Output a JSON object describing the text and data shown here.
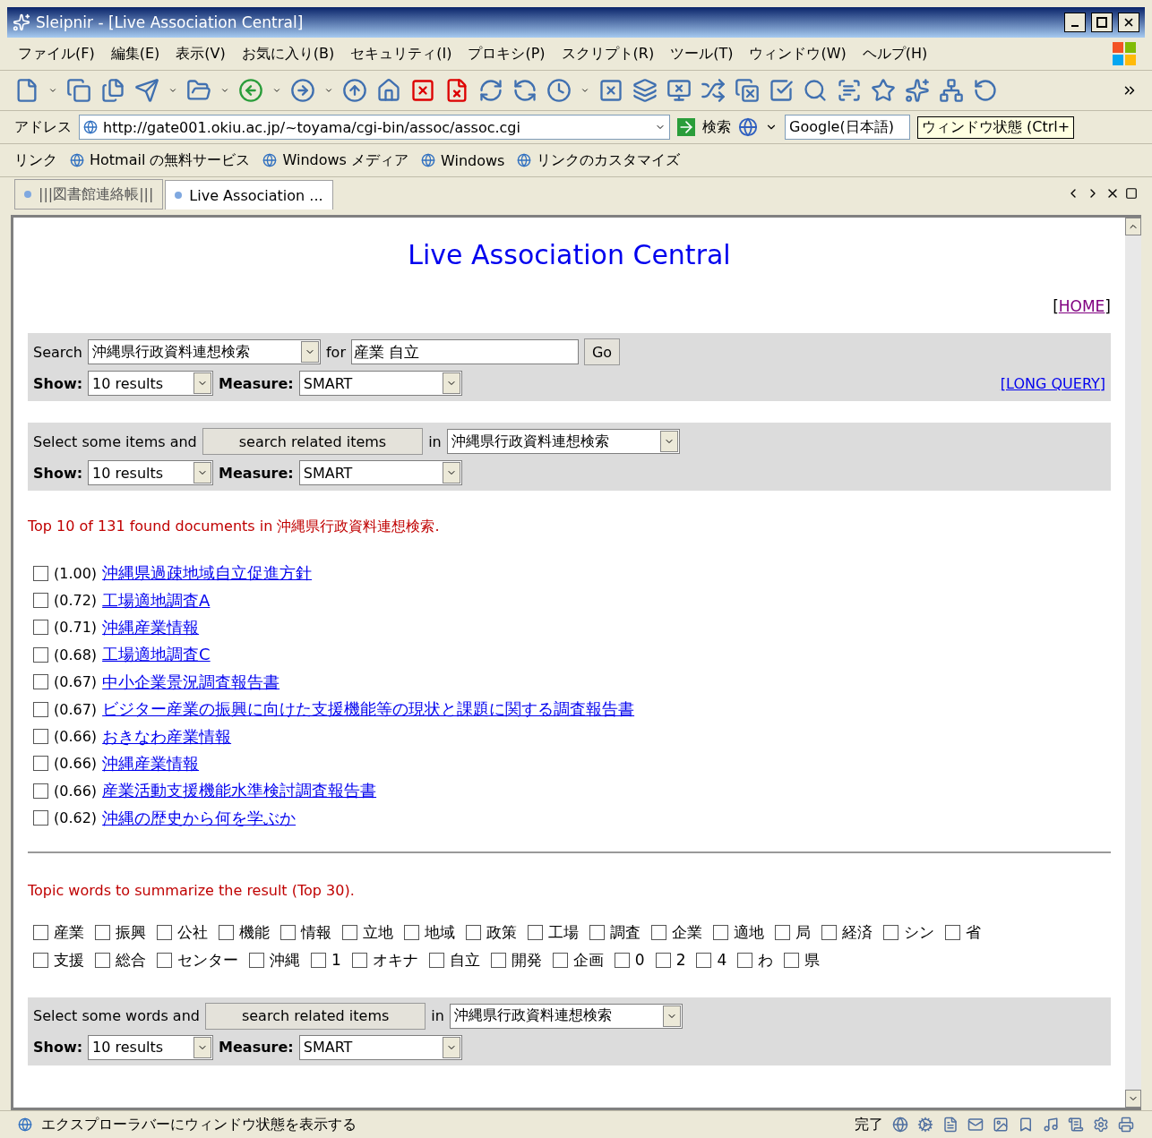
{
  "window": {
    "title": "Sleipnir - [Live Association Central]"
  },
  "menu": [
    "ファイル(F)",
    "編集(E)",
    "表示(V)",
    "お気に入り(B)",
    "セキュリティ(I)",
    "プロキシ(P)",
    "スクリプト(R)",
    "ツール(T)",
    "ウィンドウ(W)",
    "ヘルプ(H)"
  ],
  "address_bar": {
    "label": "アドレス",
    "url": "http://gate001.okiu.ac.jp/~toyama/cgi-bin/assoc/assoc.cgi",
    "search_label": "検索",
    "engine": "Google(日本語)",
    "tooltip": "ウィンドウ状態 (Ctrl+"
  },
  "links_bar": {
    "label": "リンク",
    "items": [
      "Hotmail の無料サービス",
      "Windows メディア",
      "Windows",
      "リンクのカスタマイズ"
    ]
  },
  "tabs": [
    {
      "label": "|||図書館連絡帳|||",
      "selected": false
    },
    {
      "label": "Live Association ...",
      "selected": true
    }
  ],
  "page": {
    "heading": "Live Association Central",
    "home_link": "HOME",
    "home_brackets": {
      "open": "[",
      "close": "]"
    },
    "search_form": {
      "label": "Search",
      "database": "沖縄県行政資料連想検索",
      "for_label": "for",
      "query": "産業 自立",
      "go": "Go",
      "show_label": "Show:",
      "show": "10 results",
      "measure_label": "Measure:",
      "measure": "SMART",
      "long_query": "[LONG QUERY]"
    },
    "items_form": {
      "label": "Select some items and",
      "button": "search related items",
      "in_label": "in",
      "database": "沖縄県行政資料連想検索",
      "show_label": "Show:",
      "show": "10 results",
      "measure_label": "Measure:",
      "measure": "SMART"
    },
    "summary": "Top 10 of 131 found documents in 沖縄県行政資料連想検索.",
    "results": [
      {
        "score": "(1.00)",
        "title": "沖縄県過疎地域自立促進方針",
        "checked": false
      },
      {
        "score": "(0.72)",
        "title": "工場適地調査A",
        "checked": false
      },
      {
        "score": "(0.71)",
        "title": "沖縄産業情報",
        "checked": false
      },
      {
        "score": "(0.68)",
        "title": "工場適地調査C",
        "checked": false
      },
      {
        "score": "(0.67)",
        "title": "中小企業景況調査報告書",
        "checked": false
      },
      {
        "score": "(0.67)",
        "title": "ビジター産業の振興に向けた支援機能等の現状と課題に関する調査報告書",
        "checked": false
      },
      {
        "score": "(0.66)",
        "title": "おきなわ産業情報",
        "checked": false
      },
      {
        "score": "(0.66)",
        "title": "沖縄産業情報",
        "checked": false
      },
      {
        "score": "(0.66)",
        "title": "産業活動支援機能水準検討調査報告書",
        "checked": false
      },
      {
        "score": "(0.62)",
        "title": "沖縄の歴史から何を学ぶか",
        "checked": false
      }
    ],
    "topic_heading": "Topic words to summarize the result (Top 30).",
    "topic_rows": [
      {
        "words": [
          {
            "word": "産業",
            "checked": false
          },
          {
            "word": "振興",
            "checked": false
          },
          {
            "word": "公社",
            "checked": false
          },
          {
            "word": "機能",
            "checked": false
          },
          {
            "word": "情報",
            "checked": false
          },
          {
            "word": "立地",
            "checked": false
          },
          {
            "word": "地域",
            "checked": false
          },
          {
            "word": "政策",
            "checked": false
          },
          {
            "word": "工場",
            "checked": false
          },
          {
            "word": "調査",
            "checked": false
          },
          {
            "word": "企業",
            "checked": false
          },
          {
            "word": "適地",
            "checked": false
          },
          {
            "word": "局",
            "checked": false
          },
          {
            "word": "経済",
            "checked": false
          },
          {
            "word": "シン",
            "checked": false
          },
          {
            "word": "省",
            "checked": false
          }
        ]
      },
      {
        "words": [
          {
            "word": "支援",
            "checked": false
          },
          {
            "word": "総合",
            "checked": false
          },
          {
            "word": "センター",
            "checked": false
          },
          {
            "word": "沖縄",
            "checked": false
          },
          {
            "word": "1",
            "checked": false
          },
          {
            "word": "オキナ",
            "checked": false
          },
          {
            "word": "自立",
            "checked": false
          },
          {
            "word": "開発",
            "checked": false
          },
          {
            "word": "企画",
            "checked": false
          },
          {
            "word": "0",
            "checked": false
          },
          {
            "word": "2",
            "checked": false
          },
          {
            "word": "4",
            "checked": false
          },
          {
            "word": "わ",
            "checked": false
          },
          {
            "word": "県",
            "checked": false
          }
        ]
      }
    ],
    "words_form": {
      "label": "Select some words and",
      "button": "search related items",
      "in_label": "in",
      "database": "沖縄県行政資料連想検索",
      "show_label": "Show:",
      "show": "10 results",
      "measure_label": "Measure:",
      "measure": "SMART"
    }
  },
  "status_bar": {
    "text": "エクスプローラバーにウィンドウ状態を表示する",
    "state": "完了"
  }
}
